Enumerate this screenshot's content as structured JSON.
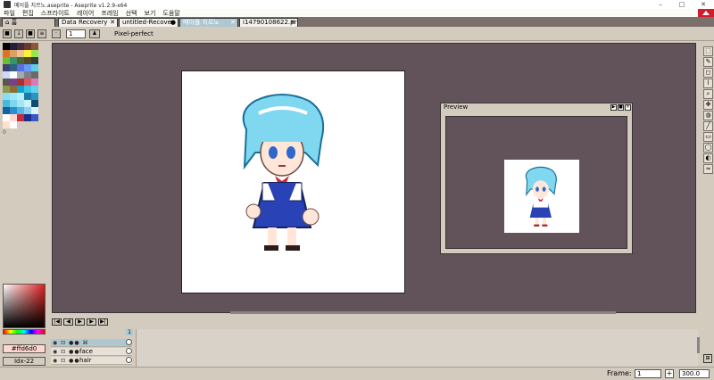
{
  "window": {
    "title": "메이플 치르노.aseprite - Aseprite v1.2.9-x64",
    "minimize": "–",
    "maximize": "□",
    "close": "✕"
  },
  "menu": [
    "파일",
    "편집",
    "스프라이트",
    "레이어",
    "프레임",
    "선택",
    "보기",
    "도움말"
  ],
  "tabs": [
    {
      "label": "홈",
      "icon": "home-icon"
    },
    {
      "label": "Data Recovery",
      "close": "✕"
    },
    {
      "label": "untitled-Recove",
      "close": "●"
    },
    {
      "label": "메이플 치르노",
      "close": "✕"
    },
    {
      "label": "i14790108622.pr",
      "close": "✕"
    }
  ],
  "context": {
    "brush_size": "1",
    "pixel_perfect": "Pixel-perfect"
  },
  "palette": {
    "colors": [
      "#000000",
      "#222034",
      "#45283c",
      "#663931",
      "#8f563b",
      "#df7126",
      "#d9a066",
      "#eec39a",
      "#fbf236",
      "#99e550",
      "#6abe30",
      "#37946e",
      "#4b692f",
      "#524b24",
      "#323c39",
      "#3f3f74",
      "#306082",
      "#5b6ee1",
      "#639bff",
      "#5fcde4",
      "#cbdbfc",
      "#ffffff",
      "#9badb7",
      "#847e87",
      "#696a6a",
      "#595652",
      "#76428a",
      "#ac3232",
      "#d95763",
      "#d77bba",
      "#8f974a",
      "#8a6f30",
      "#17a0c6",
      "#3dc4e6",
      "#60d4ee",
      "#86e0f2",
      "#9de9f7",
      "#b9eff9",
      "#1d7aa5",
      "#2b95c1",
      "#48b8dd",
      "#7ed5ee",
      "#a5e6f5",
      "#c7f1fb",
      "#0d4d74",
      "#1262a0",
      "#2a8fcf",
      "#55b6e6",
      "#8fd2f0",
      "#d9f5fd",
      "#ffffff",
      "#ffd6d0",
      "#c92a39",
      "#1a2f8a",
      "#3a58c8",
      "#ffe0c8",
      "#ffffff"
    ],
    "marker": "0"
  },
  "colors": {
    "foreground": "#ffd6d0",
    "foreground_label": "#ffd6d0",
    "background_label": "Idx-22"
  },
  "preview": {
    "title": "Preview"
  },
  "tools": [
    "marquee-icon",
    "pencil-icon",
    "eraser-icon",
    "eyedropper-icon",
    "zoom-icon",
    "move-icon",
    "bucket-icon",
    "line-icon",
    "rectangle-icon",
    "ellipse-icon",
    "contour-icon",
    "blur-icon"
  ],
  "timeline": {
    "buttons": [
      "|◀",
      "◀",
      "▶",
      "▶",
      "▶|"
    ],
    "frame_number": "1",
    "layers": [
      {
        "name": "",
        "selected": true
      },
      {
        "name": "face",
        "selected": false
      },
      {
        "name": "hair",
        "selected": false
      }
    ]
  },
  "status": {
    "frame_label": "Frame:",
    "frame_value": "1",
    "zoom": "300.0"
  }
}
